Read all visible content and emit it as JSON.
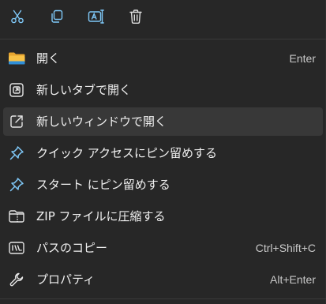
{
  "toolbar": {
    "buttons": [
      {
        "icon": "scissors-icon",
        "tooltip": "切り取り"
      },
      {
        "icon": "copy-icon",
        "tooltip": "コピー"
      },
      {
        "icon": "rename-icon",
        "tooltip": "名前の変更"
      },
      {
        "icon": "trash-icon",
        "tooltip": "削除"
      }
    ]
  },
  "menu": {
    "items": [
      {
        "label": "開く",
        "shortcut": "Enter",
        "icon": "folder-icon"
      },
      {
        "label": "新しいタブで開く",
        "shortcut": "",
        "icon": "new-tab-icon"
      },
      {
        "label": "新しいウィンドウで開く",
        "shortcut": "",
        "icon": "open-external-icon"
      },
      {
        "label": "クイック アクセスにピン留めする",
        "shortcut": "",
        "icon": "pin-icon"
      },
      {
        "label": "スタート にピン留めする",
        "shortcut": "",
        "icon": "pin-icon"
      },
      {
        "label": "ZIP ファイルに圧縮する",
        "shortcut": "",
        "icon": "zip-folder-icon"
      },
      {
        "label": "パスのコピー",
        "shortcut": "Ctrl+Shift+C",
        "icon": "copy-path-icon"
      },
      {
        "label": "プロパティ",
        "shortcut": "Alt+Enter",
        "icon": "wrench-icon"
      }
    ]
  },
  "colors": {
    "background": "#272727",
    "hover": "#383838",
    "accent": "#4cc2ff",
    "folder": "#f8c146"
  }
}
